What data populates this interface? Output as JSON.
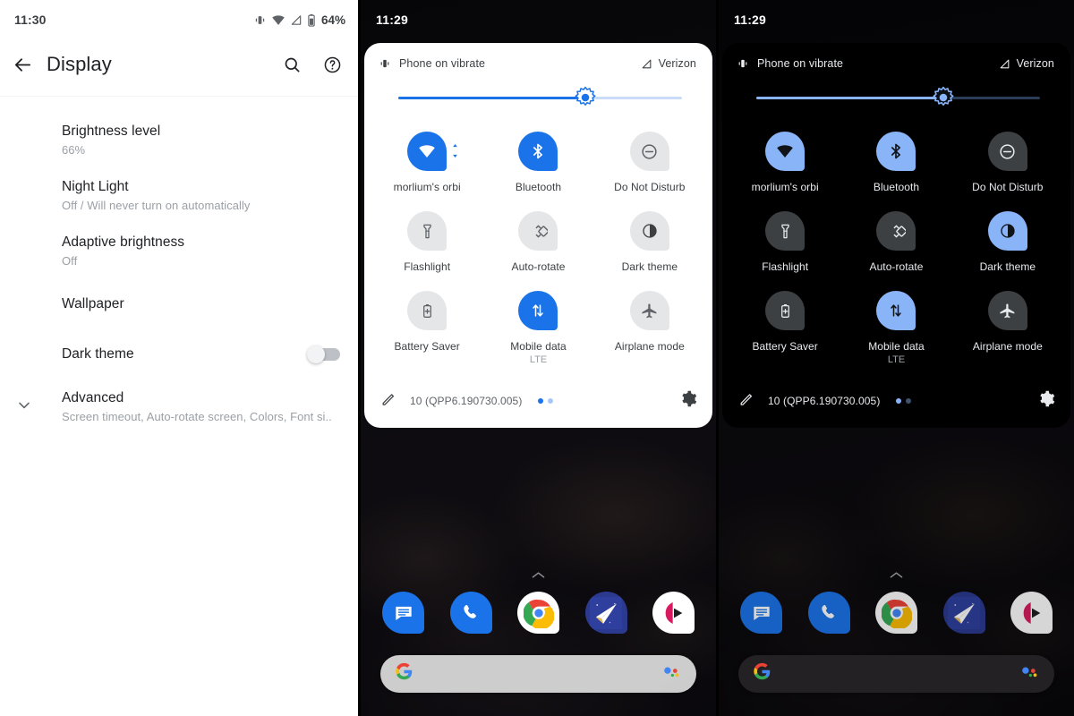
{
  "settings_screen": {
    "status_bar": {
      "time": "11:30",
      "battery_percent": "64%",
      "icons": [
        "vibrate-icon",
        "wifi-icon",
        "signal-icon",
        "battery-icon"
      ]
    },
    "appbar": {
      "back_icon": "back-arrow-icon",
      "title": "Display",
      "search_icon": "search-icon",
      "help_icon": "help-icon"
    },
    "items": [
      {
        "title": "Brightness level",
        "subtitle": "66%"
      },
      {
        "title": "Night Light",
        "subtitle": "Off / Will never turn on automatically"
      },
      {
        "title": "Adaptive brightness",
        "subtitle": "Off"
      },
      {
        "title": "Wallpaper",
        "subtitle": ""
      },
      {
        "title": "Dark theme",
        "subtitle": "",
        "toggle": "off"
      },
      {
        "title": "Advanced",
        "subtitle": "Screen timeout, Auto-rotate screen, Colors, Font si.."
      }
    ]
  },
  "quick_settings_light": {
    "status_bar": {
      "time": "11:29"
    },
    "header": {
      "ringer_icon": "vibrate-icon",
      "ringer_text": "Phone on vibrate",
      "signal_icon": "signal-icon",
      "carrier": "Verizon"
    },
    "brightness": {
      "value_percent": 66,
      "thumb_icon": "brightness-sun-icon"
    },
    "tiles": [
      {
        "label": "morlium's orbi",
        "sublabel": "",
        "icon": "wifi-icon",
        "state": "on",
        "expandable": true
      },
      {
        "label": "Bluetooth",
        "sublabel": "",
        "icon": "bluetooth-icon",
        "state": "on",
        "expandable": false
      },
      {
        "label": "Do Not Disturb",
        "sublabel": "",
        "icon": "do-not-disturb-icon",
        "state": "off",
        "expandable": false
      },
      {
        "label": "Flashlight",
        "sublabel": "",
        "icon": "flashlight-icon",
        "state": "off",
        "expandable": false
      },
      {
        "label": "Auto-rotate",
        "sublabel": "",
        "icon": "auto-rotate-icon",
        "state": "off",
        "expandable": false
      },
      {
        "label": "Dark theme",
        "sublabel": "",
        "icon": "dark-theme-icon",
        "state": "off",
        "expandable": false
      },
      {
        "label": "Battery Saver",
        "sublabel": "",
        "icon": "battery-saver-icon",
        "state": "off",
        "expandable": false
      },
      {
        "label": "Mobile data",
        "sublabel": "LTE",
        "icon": "mobile-data-icon",
        "state": "on",
        "expandable": false
      },
      {
        "label": "Airplane mode",
        "sublabel": "",
        "icon": "airplane-icon",
        "state": "off",
        "expandable": false
      }
    ],
    "footer": {
      "edit_icon": "pencil-edit-icon",
      "build": "10 (QPP6.190730.005)",
      "page_dots": 2,
      "active_dot": 1,
      "settings_icon": "gear-icon"
    },
    "home": {
      "handle_icon": "chevron-up-icon",
      "dock_apps": [
        "messages-app-icon",
        "phone-app-icon",
        "chrome-app-icon",
        "mail-app-icon",
        "gallery-app-icon"
      ],
      "search": {
        "google_icon": "google-g-icon",
        "assistant_icon": "assistant-icon"
      }
    }
  },
  "quick_settings_dark": {
    "status_bar": {
      "time": "11:29"
    },
    "header": {
      "ringer_icon": "vibrate-icon",
      "ringer_text": "Phone on vibrate",
      "signal_icon": "signal-icon",
      "carrier": "Verizon"
    },
    "brightness": {
      "value_percent": 66,
      "thumb_icon": "brightness-sun-icon"
    },
    "tiles": [
      {
        "label": "morlium's orbi",
        "sublabel": "",
        "icon": "wifi-icon",
        "state": "on",
        "expandable": false
      },
      {
        "label": "Bluetooth",
        "sublabel": "",
        "icon": "bluetooth-icon",
        "state": "on",
        "expandable": false
      },
      {
        "label": "Do Not Disturb",
        "sublabel": "",
        "icon": "do-not-disturb-icon",
        "state": "off",
        "expandable": false
      },
      {
        "label": "Flashlight",
        "sublabel": "",
        "icon": "flashlight-icon",
        "state": "off",
        "expandable": false
      },
      {
        "label": "Auto-rotate",
        "sublabel": "",
        "icon": "auto-rotate-icon",
        "state": "off",
        "expandable": false
      },
      {
        "label": "Dark theme",
        "sublabel": "",
        "icon": "dark-theme-icon",
        "state": "on",
        "expandable": false
      },
      {
        "label": "Battery Saver",
        "sublabel": "",
        "icon": "battery-saver-icon",
        "state": "off",
        "expandable": false
      },
      {
        "label": "Mobile data",
        "sublabel": "LTE",
        "icon": "mobile-data-icon",
        "state": "on",
        "expandable": false
      },
      {
        "label": "Airplane mode",
        "sublabel": "",
        "icon": "airplane-icon",
        "state": "off",
        "expandable": false
      }
    ],
    "footer": {
      "edit_icon": "pencil-edit-icon",
      "build": "10 (QPP6.190730.005)",
      "page_dots": 2,
      "active_dot": 1,
      "settings_icon": "gear-icon"
    },
    "home": {
      "handle_icon": "chevron-up-icon",
      "dock_apps": [
        "messages-app-icon",
        "phone-app-icon",
        "chrome-app-icon",
        "mail-app-icon",
        "gallery-app-icon"
      ],
      "search": {
        "google_icon": "google-g-icon",
        "assistant_icon": "assistant-icon"
      }
    }
  },
  "colors": {
    "light_accent": "#1a73e8",
    "dark_accent": "#8ab4f8",
    "light_tile_off": "#e4e6e8",
    "dark_tile_off": "#3c4043",
    "text_primary_light": "#202124",
    "text_secondary_light": "#9aa0a6",
    "text_primary_dark": "#e8eaed"
  }
}
